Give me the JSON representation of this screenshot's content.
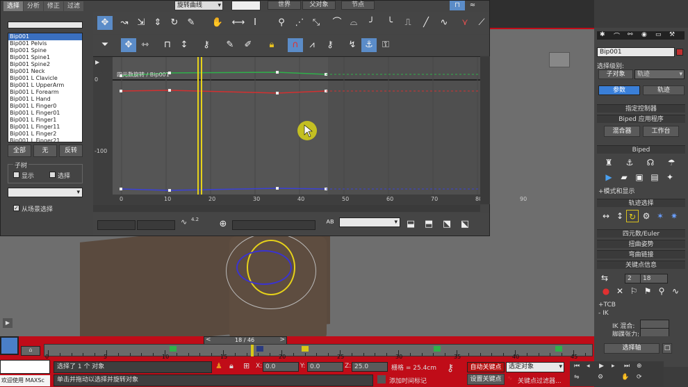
{
  "tabs": [
    "选择",
    "分析",
    "修正",
    "过滤"
  ],
  "curve_dropdown": "旋转曲线",
  "toolbar_top": {
    "world": "世界",
    "parent": "父对象",
    "node": "节点"
  },
  "objects": [
    "Bip001",
    "Bip001 Pelvis",
    "Bip001 Spine",
    "Bip001 Spine1",
    "Bip001 Spine2",
    "Bip001 Neck",
    "Bip001 L Clavicle",
    "Bip001 L UpperArm",
    "Bip001 L Forearm",
    "Bip001 L Hand",
    "Bip001 L Finger0",
    "Bip001 L Finger01",
    "Bip001 L Finger1",
    "Bip001 L Finger11",
    "Bip001 L Finger2",
    "Bip001 L Finger21"
  ],
  "list_buttons": {
    "all": "全部",
    "none": "无",
    "invert": "反转"
  },
  "children": {
    "title": "子树",
    "show": "显示",
    "select": "选择"
  },
  "from_scene": "从场景选择",
  "graph": {
    "track_label": "四元数旋转 / Bip001",
    "y_ticks": [
      "0",
      "-100"
    ],
    "x_ticks": [
      "0",
      "10",
      "20",
      "30",
      "40",
      "50",
      "60",
      "70",
      "80",
      "90"
    ],
    "tangent_value": "4.2"
  },
  "right_panel": {
    "name": "Bip001",
    "select_level_label": "选择级别:",
    "subobject": "子对象",
    "track": "轨迹",
    "params_tab": "参数",
    "tracks_tab": "轨迹",
    "rollouts": {
      "assign_controller": "指定控制器",
      "biped_apps": "Biped 应用程序",
      "biped": "Biped",
      "track_select": "轨迹选择",
      "quaternion": "四元数/Euler",
      "twist": "扭曲姿势",
      "bend": "弯曲链接",
      "key_info": "关键点信息"
    },
    "mixer": "混合器",
    "workbench": "工作台",
    "modes_display": "+模式和显示",
    "key_num": "2",
    "key_frame": "18",
    "tcb": "+TCB",
    "ik": "- IK",
    "ik_blend": "IK 混合:",
    "ankle_tension": "脚踝张力:",
    "select_axis": "选择轴"
  },
  "timeline": {
    "frame_label": "18 / 46",
    "ticks": [
      "0",
      "5",
      "10",
      "15",
      "20",
      "25",
      "30",
      "35",
      "40",
      "45"
    ]
  },
  "status": {
    "selected": "选择了 1 个 对象",
    "prompt": "单击并拖动以选择并旋转对象",
    "welcome": "欢迎使用 MAXSc",
    "x": "0.0",
    "y": "0.0",
    "z": "25.0",
    "grid": "栅格 = 25.4cm",
    "add_time_tag": "添加时间标记",
    "auto_key": "自动关键点",
    "set_key": "设置关键点",
    "selected_obj": "选定对象",
    "key_filters": "关键点过滤器..."
  },
  "colors": {
    "accent_blue": "#5b8cc8",
    "timeline_red": "#c00c18",
    "curve_green": "#2fb04a",
    "curve_red": "#d43030",
    "curve_blue": "#3a40d8",
    "cursor_yellow": "#e6d21a"
  }
}
